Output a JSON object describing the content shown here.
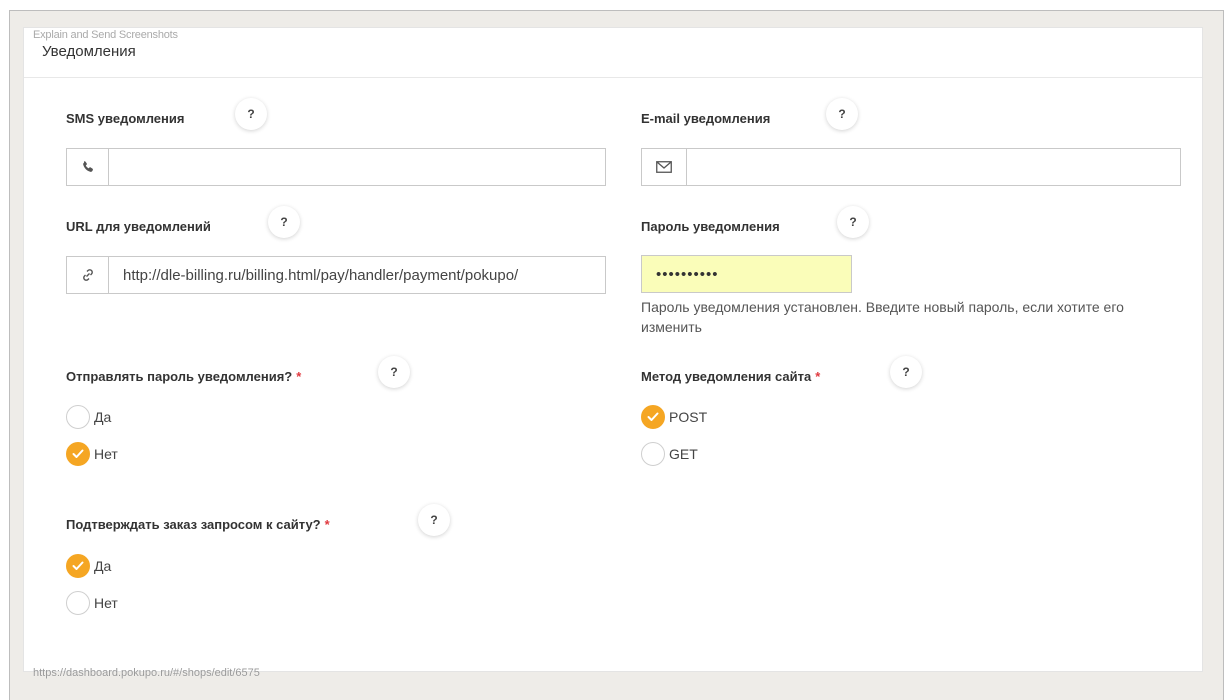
{
  "watermark": {
    "top": "Explain and Send Screenshots",
    "bottom": "https://dashboard.pokupo.ru/#/shops/edit/6575"
  },
  "panel": {
    "title": "Уведомления"
  },
  "help_label": "?",
  "sms": {
    "label": "SMS уведомления",
    "value": "",
    "icon": "phone-icon"
  },
  "email": {
    "label": "E-mail уведомления",
    "value": "",
    "icon": "envelope-icon"
  },
  "url": {
    "label": "URL для уведомлений",
    "value": "http://dle-billing.ru/billing.html/pay/handler/payment/pokupo/",
    "icon": "link-icon"
  },
  "password": {
    "label": "Пароль уведомления",
    "value": "••••••••••",
    "hint": "Пароль уведомления установлен. Введите новый пароль, если хотите его изменить"
  },
  "send_password": {
    "label": "Отправлять пароль уведомления?",
    "required_mark": "*",
    "options": [
      "Да",
      "Нет"
    ],
    "selected": "Нет"
  },
  "notify_method": {
    "label": "Метод уведомления сайта",
    "required_mark": "*",
    "options": [
      "POST",
      "GET"
    ],
    "selected": "POST"
  },
  "confirm_order": {
    "label": "Подтверждать заказ запросом к сайту?",
    "required_mark": "*",
    "options": [
      "Да",
      "Нет"
    ],
    "selected": "Да"
  },
  "colors": {
    "accent": "#f5a623",
    "required": "#e0383e",
    "password_bg": "#fafdb9"
  }
}
